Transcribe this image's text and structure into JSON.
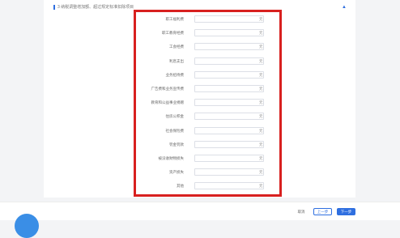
{
  "header": {
    "title": "3 纳税调整增加额、超过规定标准扣除项目",
    "collapse_icon": "chevron-up-icon"
  },
  "watermark": "",
  "unit": "元",
  "rows": [
    {
      "label": "职工福利费"
    },
    {
      "label": "职工教育经费"
    },
    {
      "label": "工会经费"
    },
    {
      "label": "利息支出"
    },
    {
      "label": "业务招待费"
    },
    {
      "label": "广告费和业务宣传费"
    },
    {
      "label": "教育和公益事业捐赠"
    },
    {
      "label": "住房公积金"
    },
    {
      "label": "社会保险费"
    },
    {
      "label": "罚金罚款"
    },
    {
      "label": "被没收财物损失"
    },
    {
      "label": "资产损失"
    },
    {
      "label": "其他"
    }
  ],
  "footer": {
    "cancel": "取消",
    "prev": "上一步",
    "next": "下一步"
  },
  "colors": {
    "accent": "#2f6fe0",
    "highlight": "#d8201f"
  }
}
